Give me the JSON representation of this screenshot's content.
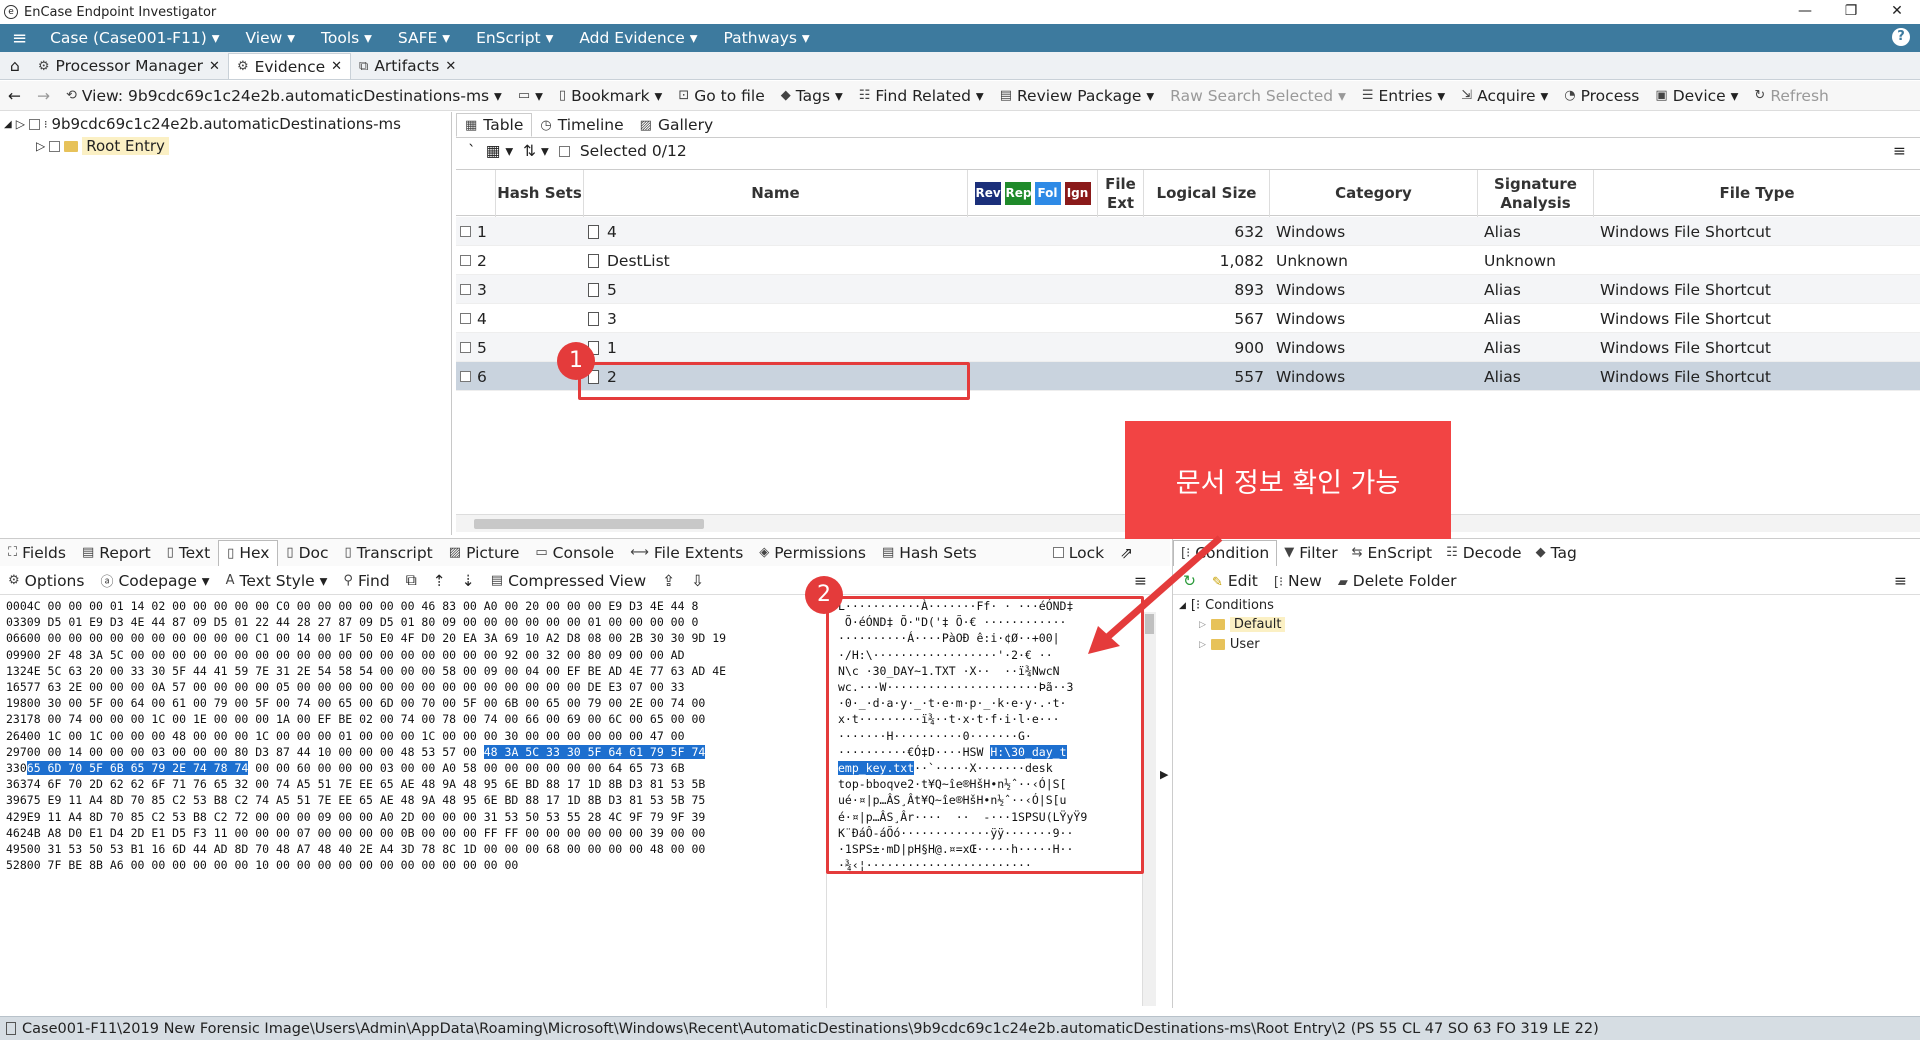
{
  "app": {
    "title": "EnCase Endpoint Investigator"
  },
  "menu": [
    "Case (Case001-F11) ▾",
    "View ▾",
    "Tools ▾",
    "SAFE ▾",
    "EnScript ▾",
    "Add Evidence ▾",
    "Pathways ▾"
  ],
  "tabs": [
    {
      "label": "Processor Manager"
    },
    {
      "label": "Evidence"
    },
    {
      "label": "Artifacts"
    }
  ],
  "toolbar": {
    "view": "View: 9b9cdc69c1c24e2b.automaticDestinations-ms ▾",
    "bookmark": "Bookmark ▾",
    "goto": "Go to file",
    "tags": "Tags ▾",
    "find_related": "Find Related ▾",
    "review_package": "Review Package ▾",
    "raw_search": "Raw Search Selected",
    "entries": "Entries ▾",
    "acquire": "Acquire ▾",
    "process": "Process",
    "device": "Device ▾",
    "refresh": "Refresh"
  },
  "tree": {
    "root": "9b9cdc69c1c24e2b.automaticDestinations-ms",
    "child": "Root Entry"
  },
  "view_tabs": [
    "Table",
    "Timeline",
    "Gallery"
  ],
  "selected": "Selected 0/12",
  "columns": {
    "hash_sets": "Hash Sets",
    "name": "Name",
    "tag1": "Rev",
    "tag2": "Rep",
    "tag3": "Fol",
    "tag4": "Ign",
    "file_ext": "File Ext",
    "logical_size": "Logical Size",
    "category": "Category",
    "signature": "Signature Analysis",
    "file_type": "File Type"
  },
  "rows": [
    {
      "idx": "1",
      "name": "4",
      "size": "632",
      "category": "Windows",
      "sig": "Alias",
      "type": "Windows File Shortcut"
    },
    {
      "idx": "2",
      "name": "DestList",
      "size": "1,082",
      "category": "Unknown",
      "sig": "Unknown",
      "type": ""
    },
    {
      "idx": "3",
      "name": "5",
      "size": "893",
      "category": "Windows",
      "sig": "Alias",
      "type": "Windows File Shortcut"
    },
    {
      "idx": "4",
      "name": "3",
      "size": "567",
      "category": "Windows",
      "sig": "Alias",
      "type": "Windows File Shortcut"
    },
    {
      "idx": "5",
      "name": "1",
      "size": "900",
      "category": "Windows",
      "sig": "Alias",
      "type": "Windows File Shortcut"
    },
    {
      "idx": "6",
      "name": "2",
      "size": "557",
      "category": "Windows",
      "sig": "Alias",
      "type": "Windows File Shortcut"
    }
  ],
  "bottom_tabs": [
    "Fields",
    "Report",
    "Text",
    "Hex",
    "Doc",
    "Transcript",
    "Picture",
    "Console",
    "File Extents",
    "Permissions",
    "Hash Sets",
    "Lock"
  ],
  "bottom_tool": {
    "options": "Options",
    "codepage": "Codepage ▾",
    "text_style": "Text Style ▾",
    "find": "Find",
    "compressed": "Compressed View"
  },
  "hex": {
    "lines": [
      {
        "off": "000",
        "pre": "4C 00 00 00 01 14 02 00 00 00 00 00 C0 00 00 00 00 00 00 46 83 00 A0 00 20 00 00 00 E9 D3 4E 44 8",
        "sel": "",
        "post": ""
      },
      {
        "off": "033",
        "pre": "09 D5 01 E9 D3 4E 44 87 09 D5 01 22 44 28 27 87 09 D5 01 80 09 00 00 00 00 00 00 01 00 00 00 00 0",
        "sel": "",
        "post": ""
      },
      {
        "off": "066",
        "pre": "00 00 00 00 00 00 00 00 00 00 00 C1 00 14 00 1F 50 E0 4F D0 20 EA 3A 69 10 A2 D8 08 00 2B 30 30 9D 19",
        "sel": "",
        "post": ""
      },
      {
        "off": "099",
        "pre": "00 2F 48 3A 5C 00 00 00 00 00 00 00 00 00 00 00 00 00 00 00 00 00 00 92 00 32 00 80 09 00 00 AD",
        "sel": "",
        "post": ""
      },
      {
        "off": "132",
        "pre": "4E 5C 63 20 00 33 30 5F 44 41 59 7E 31 2E 54 58 54 00 00 00 58 00 09 00 04 00 EF BE AD 4E 77 63 AD 4E",
        "sel": "",
        "post": ""
      },
      {
        "off": "165",
        "pre": "77 63 2E 00 00 00 0A 57 00 00 00 00 05 00 00 00 00 00 00 00 00 00 00 00 00 00 00 DE E3 07 00 33",
        "sel": "",
        "post": ""
      },
      {
        "off": "198",
        "pre": "00 30 00 5F 00 64 00 61 00 79 00 5F 00 74 00 65 00 6D 00 70 00 5F 00 6B 00 65 00 79 00 2E 00 74 00",
        "sel": "",
        "post": ""
      },
      {
        "off": "231",
        "pre": "78 00 74 00 00 00 1C 00 1E 00 00 00 1A 00 EF BE 02 00 74 00 78 00 74 00 66 00 69 00 6C 00 65 00 00",
        "sel": "",
        "post": ""
      },
      {
        "off": "264",
        "pre": "00 1C 00 1C 00 00 00 48 00 00 00 1C 00 00 00 01 00 00 00 1C 00 00 00 30 00 00 00 00 00 00 47 00",
        "sel": "",
        "post": ""
      },
      {
        "off": "297",
        "pre": "00 00 14 00 00 00 03 00 00 00 80 D3 87 44 10 00 00 00 48 53 57 00 ",
        "sel": "48 3A 5C 33 30 5F 64 61 79 5F 74",
        "post": ""
      },
      {
        "off": "330",
        "pre": "",
        "sel": "65 6D 70 5F 6B 65 79 2E 74 78 74",
        "post": " 00 00 60 00 00 00 03 00 00 A0 58 00 00 00 00 00 00 64 65 73 6B"
      },
      {
        "off": "363",
        "pre": "74 6F 70 2D 62 62 6F 71 76 65 32 00 74 A5 51 7E EE 65 AE 48 9A 48 95 6E BD 88 17 1D 8B D3 81 53 5B",
        "sel": "",
        "post": ""
      },
      {
        "off": "396",
        "pre": "75 E9 11 A4 8D 70 85 C2 53 B8 C2 74 A5 51 7E EE 65 AE 48 9A 48 95 6E BD 88 17 1D 8B D3 81 53 5B 75",
        "sel": "",
        "post": ""
      },
      {
        "off": "429",
        "pre": "E9 11 A4 8D 70 85 C2 53 B8 C2 72 00 00 00 09 00 00 A0 2D 00 00 00 31 53 50 53 55 28 4C 9F 79 9F 39",
        "sel": "",
        "post": ""
      },
      {
        "off": "462",
        "pre": "4B A8 D0 E1 D4 2D E1 D5 F3 11 00 00 00 07 00 00 00 00 0B 00 00 00 FF FF 00 00 00 00 00 00 39 00 00",
        "sel": "",
        "post": ""
      },
      {
        "off": "495",
        "pre": "00 31 53 50 53 B1 16 6D 44 AD 8D 70 48 A7 48 40 2E A4 3D 78 8C 1D 00 00 00 68 00 00 00 00 48 00 00",
        "sel": "",
        "post": ""
      },
      {
        "off": "528",
        "pre": "00 7F BE 8B A6 00 00 00 00 00 00 10 00 00 00 00 00 00 00 00 00 00 00 00",
        "sel": "",
        "post": ""
      }
    ]
  },
  "ascii": {
    "lines": [
      {
        "pre": "L···········À·······Ff· · ···éÓND‡",
        "sel": "",
        "post": ""
      },
      {
        "pre": " Õ·éÓND‡ Õ·\"D('‡ Õ·€ ············",
        "sel": "",
        "post": ""
      },
      {
        "pre": "··········Á····PàOÐ ê:i·¢Ø··+00|",
        "sel": "",
        "post": ""
      },
      {
        "pre": "·/H:\\··················'·2·€ ··",
        "sel": "",
        "post": ""
      },
      {
        "pre": "N\\c ·30_DAY~1.TXT ·X··  ··ï¾­Nwc­N",
        "sel": "",
        "post": ""
      },
      {
        "pre": "wc.···W······················Þã··3",
        "sel": "",
        "post": ""
      },
      {
        "pre": "·0·_·d·a·y·_·t·e·m·p·_·k·e·y·.·t·",
        "sel": "",
        "post": ""
      },
      {
        "pre": "x·t·········ï¾··t·x·t·f·i·l·e···",
        "sel": "",
        "post": ""
      },
      {
        "pre": "·······H··········0·······G·",
        "sel": "",
        "post": ""
      },
      {
        "pre": "··········€Ó‡D····HSW ",
        "sel": "H:\\30_day_t",
        "post": ""
      },
      {
        "pre": "",
        "sel": "emp_key.txt",
        "post": "··`·····X·······desk"
      },
      {
        "pre": "top-bboqve2·t¥Q~îe®HšH•n½ˆ··‹Ó|S[",
        "sel": "",
        "post": ""
      },
      {
        "pre": "ué·¤|p…ÂS¸Ât¥Q~îe®HšH•n½ˆ··‹Ó|S[u",
        "sel": "",
        "post": ""
      },
      {
        "pre": "é·¤|p…ÂS¸Âr····  ··  -···1SPSU(LŸyŸ9",
        "sel": "",
        "post": ""
      },
      {
        "pre": "K¨ÐáÔ-áÕó·············ÿÿ·······9··",
        "sel": "",
        "post": ""
      },
      {
        "pre": "·1SPS±·mD­|pH§H@.¤=xŒ·····h·····H··",
        "sel": "",
        "post": ""
      },
      {
        "pre": "·¾‹¦························",
        "sel": "",
        "post": ""
      }
    ]
  },
  "right_tabs": [
    "Condition",
    "Filter",
    "EnScript",
    "Decode",
    "Tag"
  ],
  "right_tool": {
    "edit": "Edit",
    "new": "New",
    "delete": "Delete Folder"
  },
  "conditions": {
    "root": "Conditions",
    "default": "Default",
    "user": "User"
  },
  "status": "Case001-F11\\2019 New Forensic Image\\Users\\Admin\\AppData\\Roaming\\Microsoft\\Windows\\Recent\\AutomaticDestinations\\9b9cdc69c1c24e2b.automaticDestinations-ms\\Root Entry\\2 (PS 55 CL 47 SO 63 FO 319 LE 22)",
  "annotations": {
    "badge1": "1",
    "badge2": "2",
    "callout": "문서 정보 확인 가능"
  },
  "colors": {
    "menubar": "#3d7a9e",
    "selection": "#1d6fcf",
    "annotation": "#e43b3b",
    "callout": "#f24444"
  }
}
